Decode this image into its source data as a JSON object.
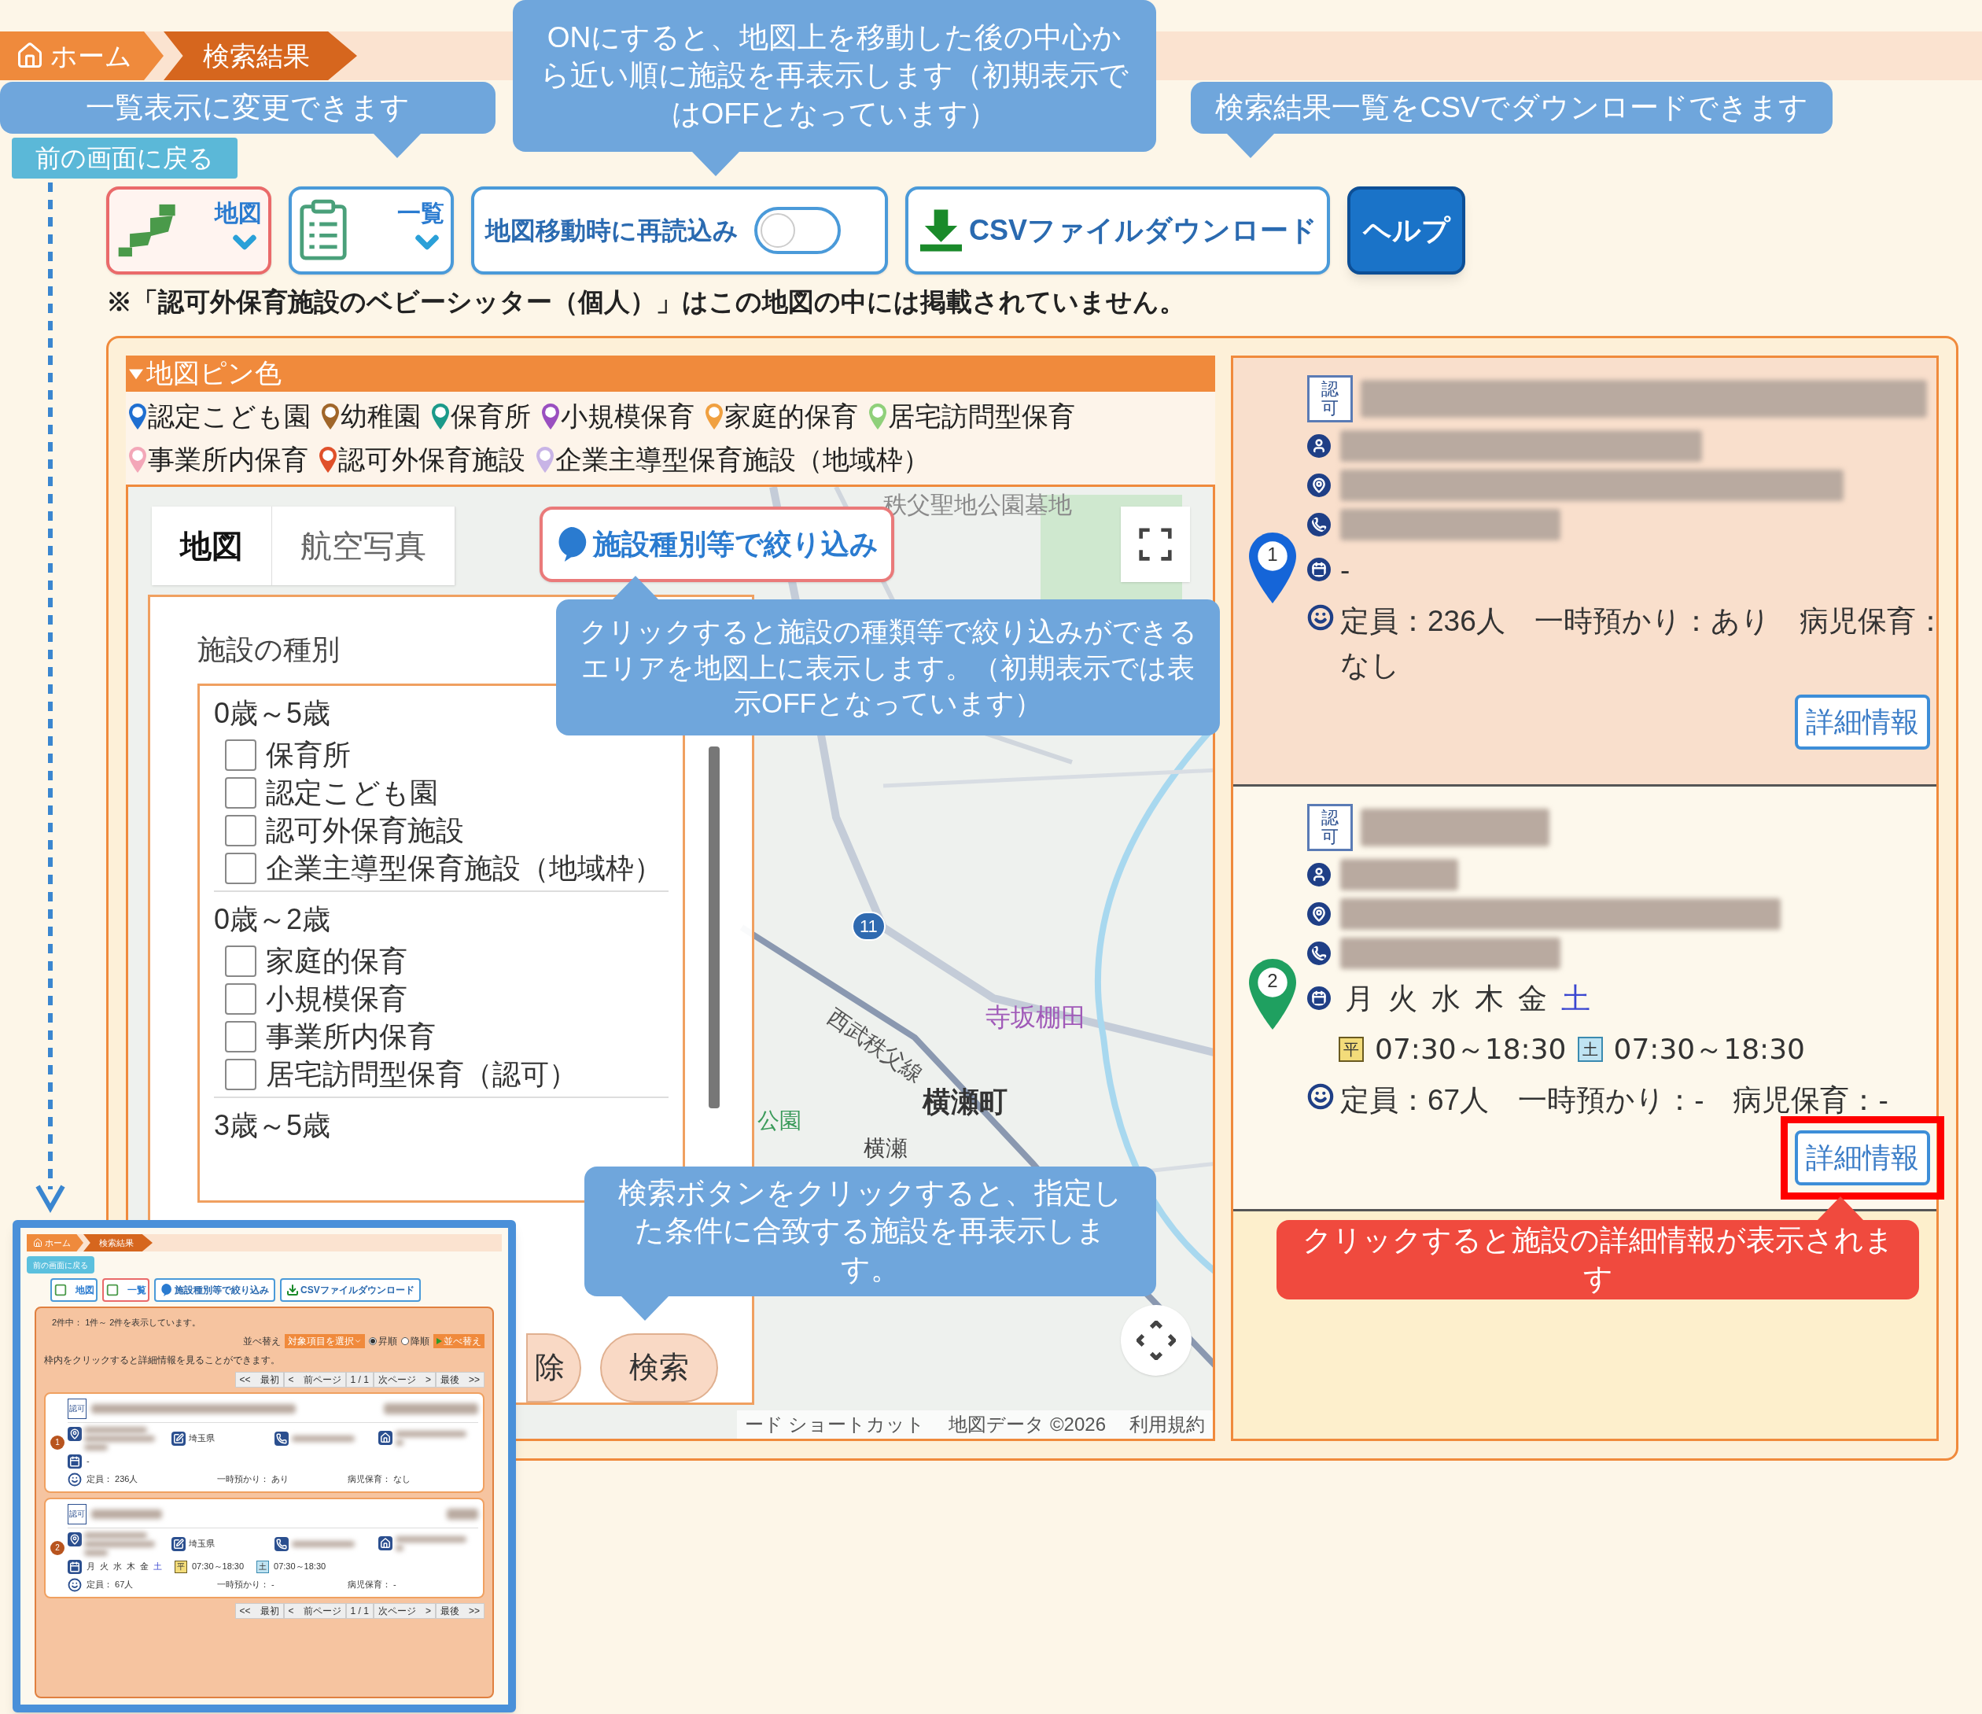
{
  "breadcrumb": [
    {
      "label": "ホーム",
      "kind": "home"
    },
    {
      "label": "検索結果",
      "kind": "current"
    }
  ],
  "back_button": "前の画面に戻る",
  "toolbar": {
    "views": [
      {
        "label": "地図",
        "kind": "map",
        "selected": true
      },
      {
        "label": "一覧",
        "kind": "list",
        "selected": false
      }
    ],
    "reload": {
      "label": "地図移動時に再読込み",
      "on": false
    },
    "csv_button": "CSVファイルダウンロード",
    "help_button": "ヘルプ"
  },
  "notice": "※「認可外保育施設のベビーシッター（個人）」はこの地図の中には掲載されていません。",
  "pin_legend": {
    "title": "地図ピン色",
    "expanded": true,
    "items": [
      {
        "label": "認定こども園",
        "color": "#1f6fd1"
      },
      {
        "label": "幼稚園",
        "color": "#a0662a"
      },
      {
        "label": "保育所",
        "color": "#1b9a8a"
      },
      {
        "label": "小規模保育",
        "color": "#9a4fc0"
      },
      {
        "label": "家庭的保育",
        "color": "#f0a040"
      },
      {
        "label": "居宅訪問型保育",
        "color": "#8fd07a"
      },
      {
        "label": "事業所内保育",
        "color": "#f3a7b8"
      },
      {
        "label": "認可外保育施設",
        "color": "#e0502a"
      },
      {
        "label": "企業主導型保育施設（地域枠）",
        "color": "#c8b4e6"
      }
    ]
  },
  "map": {
    "tabs": [
      {
        "label": "地図",
        "selected": true
      },
      {
        "label": "航空写真",
        "selected": false
      }
    ],
    "filter_button": "施設種別等で絞り込み",
    "places": [
      {
        "label": "秩父聖地公園墓地",
        "kind": "landmark"
      },
      {
        "label": "寺坂棚田",
        "kind": "poi"
      },
      {
        "label": "西武秩父線",
        "kind": "railway"
      },
      {
        "label": "横瀬町",
        "kind": "town"
      },
      {
        "label": "横瀬",
        "kind": "station"
      },
      {
        "label": "公園",
        "kind": "park"
      }
    ],
    "route": "11",
    "footer": [
      "ード ショートカット",
      "地図データ ©2026",
      "利用規約"
    ],
    "filter_panel": {
      "title": "施設の種別",
      "groups": [
        {
          "label": "0歳～5歳",
          "options": [
            {
              "label": "保育所",
              "checked": false
            },
            {
              "label": "認定こども園",
              "checked": false
            },
            {
              "label": "認可外保育施設",
              "checked": false
            },
            {
              "label": "企業主導型保育施設（地域枠）",
              "checked": false
            }
          ]
        },
        {
          "label": "0歳～2歳",
          "options": [
            {
              "label": "家庭的保育",
              "checked": false
            },
            {
              "label": "小規模保育",
              "checked": false
            },
            {
              "label": "事業所内保育",
              "checked": false
            },
            {
              "label": "居宅訪問型保育（認可）",
              "checked": false
            }
          ]
        },
        {
          "label": "3歳～5歳"
        }
      ],
      "buttons": [
        "除",
        "検索"
      ]
    }
  },
  "results": [
    {
      "number": "1",
      "color": "#1565d8",
      "highlighted": true,
      "license": "認可",
      "schedule": "-",
      "capacity": "定員：236人　一時預かり：あり　病児保育：なし",
      "detail_button": "詳細情報"
    },
    {
      "number": "2",
      "color": "#1fa060",
      "highlighted": false,
      "license": "認可",
      "days": [
        {
          "label": "月",
          "kind": "weekday"
        },
        {
          "label": "火",
          "kind": "weekday"
        },
        {
          "label": "水",
          "kind": "weekday"
        },
        {
          "label": "木",
          "kind": "weekday"
        },
        {
          "label": "金",
          "kind": "weekday"
        },
        {
          "label": "土",
          "kind": "saturday"
        }
      ],
      "hours": [
        {
          "badge": "平",
          "kind": "weekday",
          "time": "07:30～18:30"
        },
        {
          "badge": "土",
          "kind": "saturday",
          "time": "07:30～18:30"
        }
      ],
      "capacity": "定員：67人　一時預かり：-　病児保育：-",
      "detail_button": "詳細情報"
    }
  ],
  "callouts": [
    {
      "text": "一覧表示に変更できます",
      "kind": "info"
    },
    {
      "text": "ONにすると、地図上を移動した後の中心から近い順に施設を再表示します（初期表示ではOFFとなっています）",
      "kind": "info"
    },
    {
      "text": "検索結果一覧をCSVでダウンロードできます",
      "kind": "info"
    },
    {
      "text": "クリックすると施設の種類等で絞り込みができるエリアを地図上に表示します。（初期表示では表示OFFとなっています）",
      "kind": "info"
    },
    {
      "text": "検索ボタンをクリックすると、指定した条件に合致する施設を再表示します。",
      "kind": "info"
    },
    {
      "text": "クリックすると施設の詳細情報が表示されます",
      "kind": "alert"
    }
  ],
  "inset": {
    "breadcrumb": [
      {
        "label": "ホーム",
        "kind": "home"
      },
      {
        "label": "検索結果",
        "kind": "current"
      }
    ],
    "back_button": "前の画面に戻る",
    "toolbar": [
      {
        "label": "地図",
        "kind": "map",
        "selected": false
      },
      {
        "label": "一覧",
        "kind": "list",
        "selected": true
      },
      {
        "label": "施設種別等で絞り込み",
        "kind": "filter"
      },
      {
        "label": "CSVファイルダウンロード",
        "kind": "csv"
      }
    ],
    "summary": "2件中： 1件～ 2件を表示しています。",
    "sort": {
      "label": "並べ替え",
      "select": "対象項目を選択",
      "options": [
        {
          "label": "昇順",
          "selected": true
        },
        {
          "label": "降順",
          "selected": false
        }
      ],
      "button": "並べ替え"
    },
    "hint": "枠内をクリックすると詳細情報を見ることができます。",
    "pagination": [
      "<<　最初",
      "<　前ページ",
      "1 / 1",
      "次ページ　>",
      "最後　>>"
    ],
    "cards": [
      {
        "number": "1",
        "license": "認可",
        "prefecture": "埼玉県",
        "schedule": "-",
        "capacity": [
          "定員： 236人",
          "一時預かり： あり",
          "病児保育： なし"
        ]
      },
      {
        "number": "2",
        "license": "認可",
        "prefecture": "埼玉県",
        "days": [
          {
            "label": "月",
            "kind": "weekday"
          },
          {
            "label": "火",
            "kind": "weekday"
          },
          {
            "label": "水",
            "kind": "weekday"
          },
          {
            "label": "木",
            "kind": "weekday"
          },
          {
            "label": "金",
            "kind": "weekday"
          },
          {
            "label": "土",
            "kind": "saturday"
          }
        ],
        "hours": [
          {
            "badge": "平",
            "kind": "weekday",
            "time": "07:30～18:30"
          },
          {
            "badge": "土",
            "kind": "saturday",
            "time": "07:30～18:30"
          }
        ],
        "capacity": [
          "定員： 67人",
          "一時預かり： -",
          "病児保育： -"
        ]
      }
    ],
    "pagination_bottom": [
      "<<　最初",
      "<　前ページ",
      "1 / 1",
      "次ページ　>",
      "最後　>>"
    ]
  }
}
